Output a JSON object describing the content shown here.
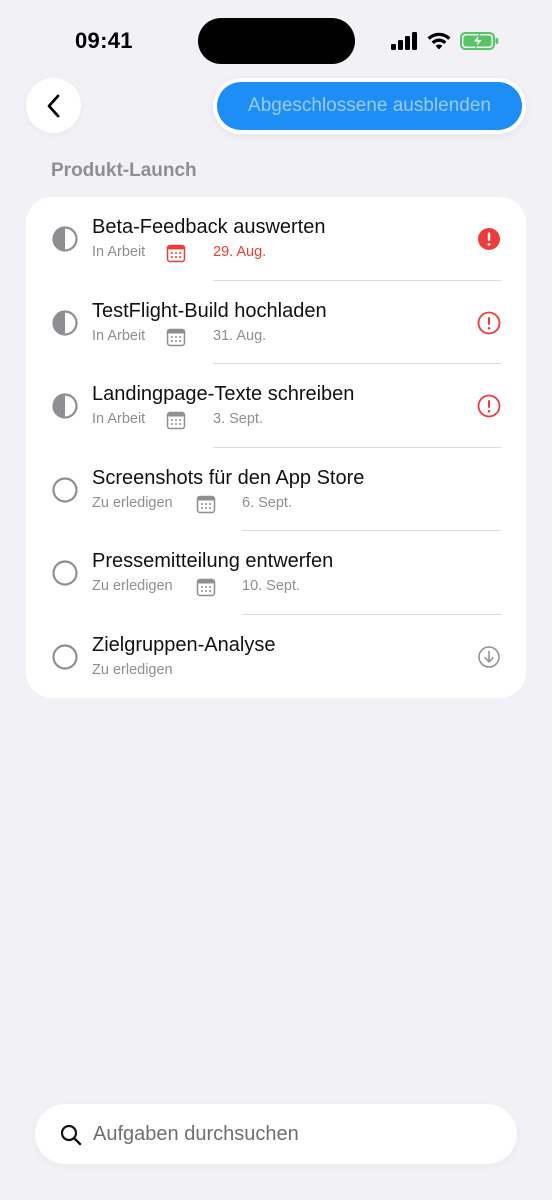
{
  "status_bar": {
    "time": "09:41"
  },
  "header": {
    "hide_completed_label": "Abgeschlossene ausblenden"
  },
  "section": {
    "title": "Produkt-Launch"
  },
  "tasks": [
    {
      "title": "Beta-Feedback auswerten",
      "status": "In Arbeit",
      "date": "29. Aug.",
      "state": "in-progress",
      "overdue": true,
      "priority": "high-filled"
    },
    {
      "title": "TestFlight-Build hochladen",
      "status": "In Arbeit",
      "date": "31. Aug.",
      "state": "in-progress",
      "overdue": false,
      "priority": "high-outline"
    },
    {
      "title": "Landingpage-Texte schreiben",
      "status": "In Arbeit",
      "date": "3. Sept.",
      "state": "in-progress",
      "overdue": false,
      "priority": "high-outline"
    },
    {
      "title": "Screenshots für den App Store",
      "status": "Zu erledigen",
      "date": "6. Sept.",
      "state": "todo",
      "overdue": false,
      "priority": "none"
    },
    {
      "title": "Pressemitteilung entwerfen",
      "status": "Zu erledigen",
      "date": "10. Sept.",
      "state": "todo",
      "overdue": false,
      "priority": "none"
    },
    {
      "title": "Zielgruppen-Analyse",
      "status": "Zu erledigen",
      "date": "",
      "state": "todo",
      "overdue": false,
      "priority": "low"
    }
  ],
  "search": {
    "placeholder": "Aufgaben durchsuchen",
    "value": ""
  },
  "colors": {
    "accent": "#1C8EF5",
    "overdue": "#EE3B3B",
    "secondary_text": "#8E8E93",
    "background": "#F2F1F6"
  }
}
